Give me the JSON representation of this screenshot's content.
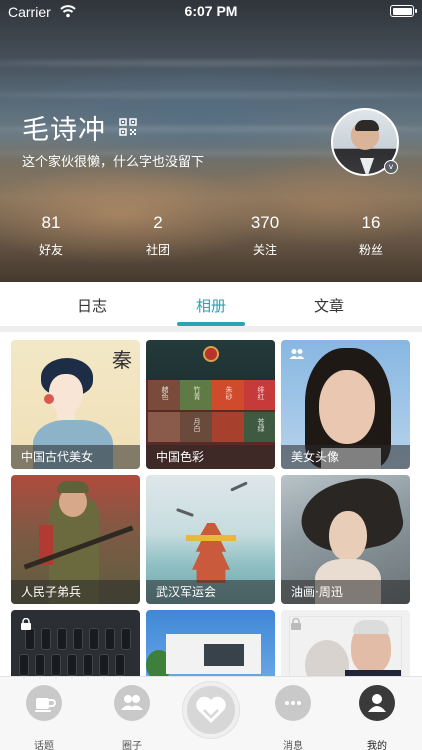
{
  "status_bar": {
    "carrier": "Carrier",
    "time": "6:07 PM"
  },
  "profile": {
    "name": "毛诗冲",
    "bio": "这个家伙很懒，什么字也没留下",
    "stats": [
      {
        "value": "81",
        "label": "好友"
      },
      {
        "value": "2",
        "label": "社团"
      },
      {
        "value": "370",
        "label": "关注"
      },
      {
        "value": "16",
        "label": "粉丝"
      }
    ],
    "badge": "v"
  },
  "tabs": [
    {
      "label": "日志",
      "active": false
    },
    {
      "label": "相册",
      "active": true
    },
    {
      "label": "文章",
      "active": false
    }
  ],
  "accent_color": "#2aa3b2",
  "albums": [
    {
      "title": "中国古代美女",
      "icon": null
    },
    {
      "title": "中国色彩",
      "icon": null
    },
    {
      "title": "美女头像",
      "icon": "people-icon"
    },
    {
      "title": "人民子弟兵",
      "icon": null
    },
    {
      "title": "武汉军运会",
      "icon": null
    },
    {
      "title": "油画·周迅",
      "icon": null
    },
    {
      "title": "",
      "icon": "lock-icon"
    },
    {
      "title": "",
      "icon": null
    },
    {
      "title": "",
      "icon": "lock-icon"
    }
  ],
  "album_art_text": {
    "seal_char": "秦",
    "color_names": [
      "赭色",
      "竹青",
      "朱砂",
      "绯红",
      "月白",
      "苍绿"
    ]
  },
  "tabbar": [
    {
      "label": "话题",
      "icon": "coffee-icon",
      "active": false
    },
    {
      "label": "圈子",
      "icon": "group-icon",
      "active": false
    },
    {
      "label": "",
      "icon": "heart-hands-icon",
      "active": false
    },
    {
      "label": "消息",
      "icon": "chat-bubble-icon",
      "active": false
    },
    {
      "label": "我的",
      "icon": "user-icon",
      "active": true
    }
  ]
}
